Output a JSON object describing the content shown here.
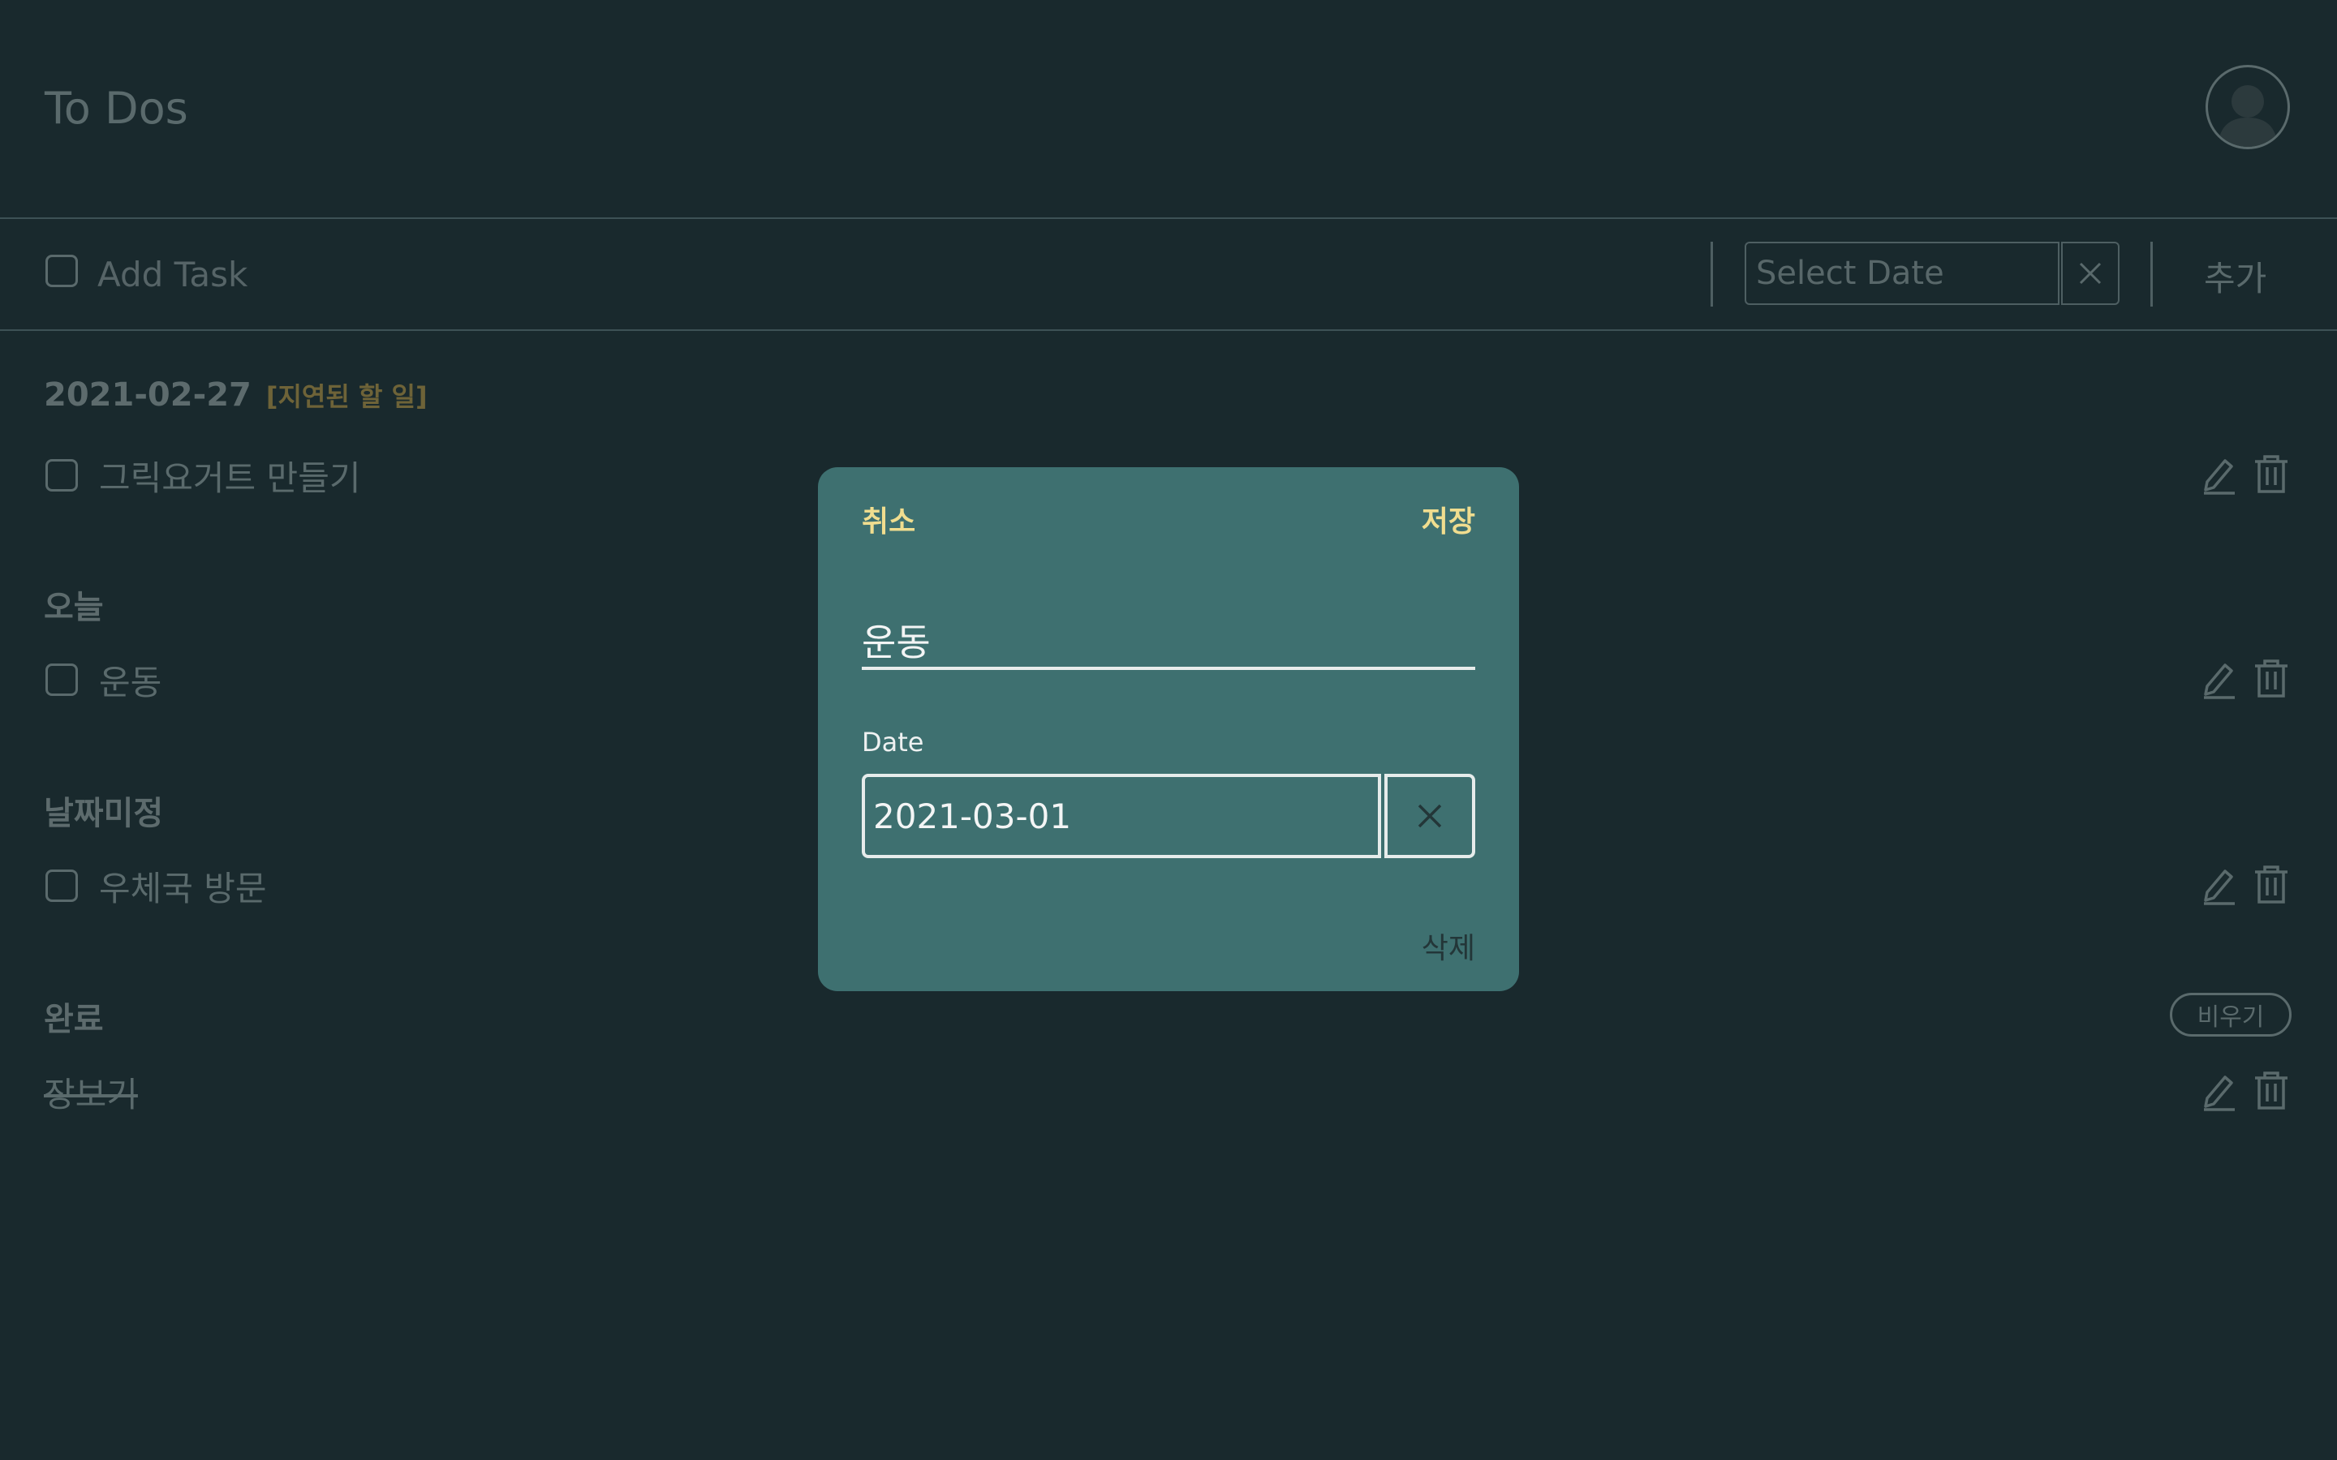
{
  "header": {
    "title": "To Dos"
  },
  "add_bar": {
    "task_placeholder": "Add Task",
    "date_placeholder": "Select Date",
    "add_label": "추가"
  },
  "sections": {
    "overdue": {
      "title": "2021-02-27",
      "badge": "[지연된 할 일]",
      "tasks": [
        "그릭요거트 만들기"
      ]
    },
    "today": {
      "title": "오늘",
      "tasks": [
        "운동"
      ]
    },
    "undated": {
      "title": "날짜미정",
      "tasks": [
        "우체국 방문"
      ]
    },
    "completed": {
      "title": "완료",
      "clear_label": "비우기",
      "tasks": [
        "장보기"
      ]
    }
  },
  "modal": {
    "cancel_label": "취소",
    "save_label": "저장",
    "task_value": "운동",
    "date_label": "Date",
    "date_value": "2021-03-01",
    "delete_label": "삭제"
  },
  "colors": {
    "background": "#19292d",
    "modal_background": "#3e7070",
    "accent": "#f0dd8f",
    "muted_text": "#5a6a6c",
    "overdue_badge": "#6e6338"
  },
  "icons": {
    "avatar": "user-avatar-icon",
    "clear": "close-icon",
    "edit": "pencil-icon",
    "delete": "trash-icon"
  }
}
